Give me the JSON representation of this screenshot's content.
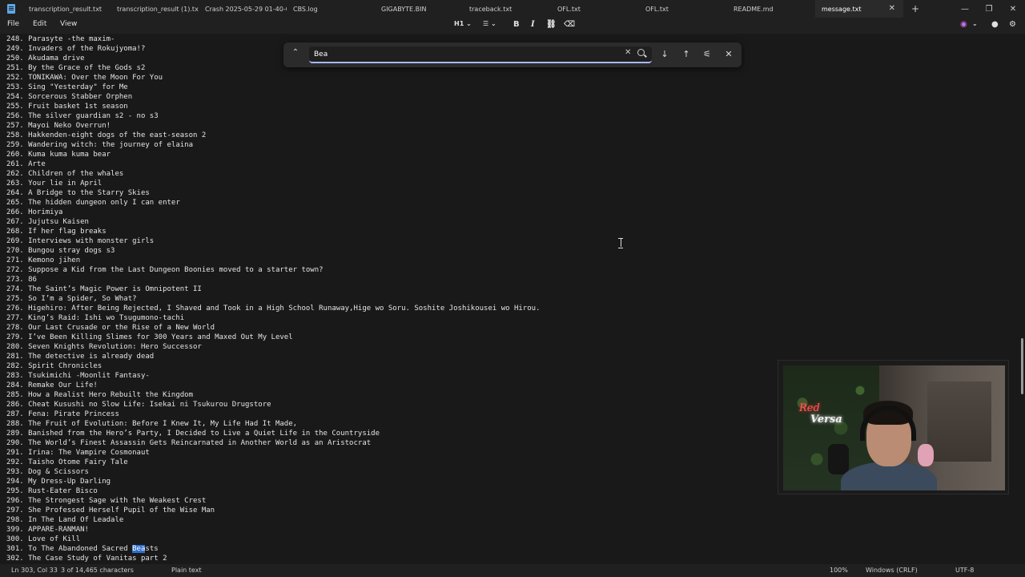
{
  "tabs": [
    {
      "label": "transcription_result.txt",
      "active": false
    },
    {
      "label": "transcription_result (1).txt",
      "active": false
    },
    {
      "label": "Crash 2025-05-29 01-40-04.t",
      "active": false
    },
    {
      "label": "CBS.log",
      "active": false
    },
    {
      "label": "GIGABYTE.BIN",
      "active": false
    },
    {
      "label": "traceback.txt",
      "active": false
    },
    {
      "label": "OFL.txt",
      "active": false
    },
    {
      "label": "OFL.txt",
      "active": false
    },
    {
      "label": "README.md",
      "active": false
    },
    {
      "label": "message.txt",
      "active": true
    }
  ],
  "menu": {
    "file": "File",
    "edit": "Edit",
    "view": "View"
  },
  "toolbar": {
    "heading": "H1",
    "bold": "B",
    "italic": "I"
  },
  "find": {
    "query": "Bea"
  },
  "lines": [
    "248. Parasyte -the maxim-",
    "249. Invaders of the Rokujyoma!?",
    "250. Akudama drive",
    "251. By the Grace of the Gods s2",
    "252. TONIKAWA: Over the Moon For You",
    "253. Sing \"Yesterday\" for Me",
    "254. Sorcerous Stabber Orphen",
    "255. Fruit basket 1st season",
    "256. The silver guardian s2 - no s3",
    "257. Mayoi Neko Overrun!",
    "258. Hakkenden-eight dogs of the east-season 2",
    "259. Wandering witch: the journey of elaina",
    "260. Kuma kuma kuma bear",
    "261. Arte",
    "262. Children of the whales",
    "263. Your lie in April",
    "264. A Bridge to the Starry Skies",
    "265. The hidden dungeon only I can enter",
    "266. Horimiya",
    "267. Jujutsu Kaisen",
    "268. If her flag breaks",
    "269. Interviews with monster girls",
    "270. Bungou stray dogs s3",
    "271. Kemono jihen",
    "272. Suppose a Kid from the Last Dungeon Boonies moved to a starter town?",
    "273. 86",
    "274. The Saint’s Magic Power is Omnipotent II",
    "275. So I’m a Spider, So What?",
    "276. Higehiro: After Being Rejected, I Shaved and Took in a High School Runaway,Hige wo Soru. Soshite Joshikousei wo Hirou.",
    "277. King’s Raid: Ishi wo Tsugumono-tachi",
    "278. Our Last Crusade or the Rise of a New World",
    "279. I’ve Been Killing Slimes for 300 Years and Maxed Out My Level",
    "280. Seven Knights Revolution: Hero Successor",
    "281. The detective is already dead",
    "282. Spirit Chronicles",
    "283. Tsukimichi -Moonlit Fantasy-",
    "284. Remake Our Life!",
    "285. How a Realist Hero Rebuilt the Kingdom",
    "286. Cheat Kusushi no Slow Life: Isekai ni Tsukurou Drugstore",
    "287. Fena: Pirate Princess",
    "288. The Fruit of Evolution: Before I Knew It, My Life Had It Made,",
    "289. Banished from the Hero’s Party, I Decided to Live a Quiet Life in the Countryside",
    "290. The World’s Finest Assassin Gets Reincarnated in Another World as an Aristocrat",
    "291. Irina: The Vampire Cosmonaut",
    "292. Taisho Otome Fairy Tale",
    "293. Dog & Scissors",
    "294. My Dress-Up Darling",
    "295. Rust-Eater Bisco",
    "296. The Strongest Sage with the Weakest Crest",
    "297. She Professed Herself Pupil of the Wise Man",
    "298. In The Land Of Leadale",
    "399. APPARE-RANMAN!",
    "300. Love of Kill",
    "301. To The Abandoned Sacred Beasts",
    "302. The Case Study of Vanitas part 2"
  ],
  "match": {
    "before": "301. To The Abandoned Sacred ",
    "hit": "Bea",
    "after": "sts"
  },
  "webcam": {
    "logo_line1": "Red",
    "logo_line2": "Versa"
  },
  "status": {
    "position": "Ln 303, Col 33",
    "count": "3 of 14,465 characters",
    "format": "Plain text",
    "zoom": "100%",
    "line_ending": "Windows (CRLF)",
    "encoding": "UTF-8"
  }
}
